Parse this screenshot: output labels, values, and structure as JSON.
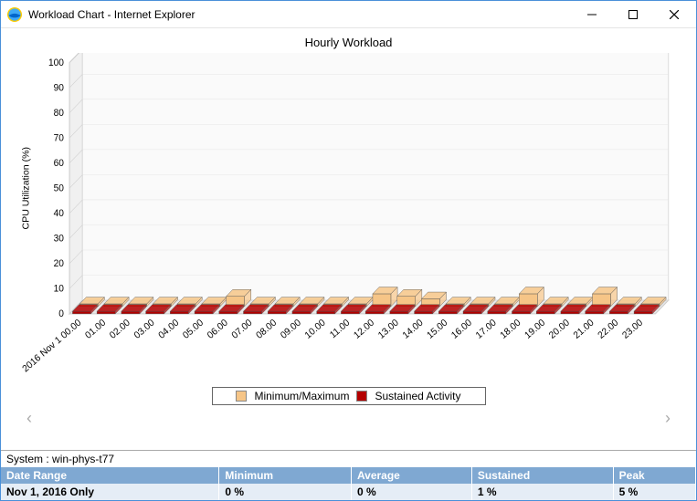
{
  "window": {
    "title": "Workload Chart - Internet Explorer"
  },
  "chart_data": {
    "type": "bar",
    "title": "Hourly Workload",
    "ylabel": "CPU Utilization (%)",
    "xlabel": "",
    "ylim": [
      0,
      100
    ],
    "yticks": [
      0,
      10,
      20,
      30,
      40,
      50,
      60,
      70,
      80,
      90,
      100
    ],
    "categories": [
      "2016 Nov 1 00.00",
      "01.00",
      "02.00",
      "03.00",
      "04.00",
      "05.00",
      "06.00",
      "07.00",
      "08.00",
      "09.00",
      "10.00",
      "11.00",
      "12.00",
      "13.00",
      "14.00",
      "15.00",
      "16.00",
      "17.00",
      "18.00",
      "19.00",
      "20.00",
      "21.00",
      "22.00",
      "23.00"
    ],
    "series": [
      {
        "name": "Minimum/Maximum",
        "color": "#f6c587",
        "values": [
          1,
          1,
          1,
          1,
          1,
          1,
          4,
          1,
          1,
          1,
          1,
          1,
          5,
          4,
          3,
          1,
          1,
          1,
          5,
          1,
          1,
          5,
          1,
          1
        ]
      },
      {
        "name": "Sustained Activity",
        "color": "#b40000",
        "values": [
          1,
          1,
          1,
          1,
          1,
          1,
          1,
          1,
          1,
          1,
          1,
          1,
          1,
          1,
          1,
          1,
          1,
          1,
          1,
          1,
          1,
          1,
          1,
          1
        ]
      }
    ],
    "legend": [
      "Minimum/Maximum",
      "Sustained Activity"
    ]
  },
  "legend_items": [
    {
      "label": "Minimum/Maximum",
      "color": "#f6c587"
    },
    {
      "label": "Sustained Activity",
      "color": "#b40000"
    }
  ],
  "system_line": {
    "label": "System :",
    "value": "win-phys-t77"
  },
  "summary": {
    "headers": [
      "Date Range",
      "Minimum",
      "Average",
      "Sustained",
      "Peak"
    ],
    "row": {
      "date_range": "Nov 1, 2016 Only",
      "minimum": "0 %",
      "average": "0 %",
      "sustained": "1 %",
      "peak": "5 %"
    }
  }
}
